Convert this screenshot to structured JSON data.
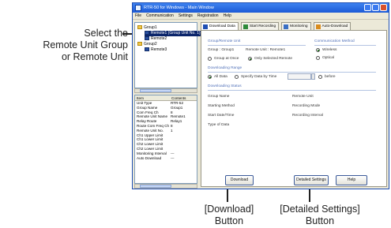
{
  "window": {
    "title": "RTR-50 for Windows - Main Window",
    "menu": [
      "File",
      "Communication",
      "Settings",
      "Registration",
      "Help"
    ]
  },
  "tree": {
    "items": [
      {
        "label": "Group1",
        "type": "folder"
      },
      {
        "label": "Remote1 (Group Unit No. 1)",
        "type": "unit",
        "selected": true
      },
      {
        "label": "Remote2",
        "type": "unit"
      },
      {
        "label": "Group2",
        "type": "folder"
      },
      {
        "label": "Remote3",
        "type": "unit"
      }
    ]
  },
  "props": {
    "head_item": "Item",
    "head_contents": "Contents",
    "rows": [
      {
        "k": "Unit Type",
        "v": "RTR-52"
      },
      {
        "k": "Group Name",
        "v": "Group1"
      },
      {
        "k": "Com Freq Ch",
        "v": "8"
      },
      {
        "k": "Remote Unit Name",
        "v": "Remote1"
      },
      {
        "k": "Relay Route",
        "v": "Relay1"
      },
      {
        "k": "Route Com Freq Ch",
        "v": "8"
      },
      {
        "k": "Remote Unit No.",
        "v": "1"
      },
      {
        "k": "Ch1 Upper Limit",
        "v": ""
      },
      {
        "k": "Ch1 Lower Limit",
        "v": ""
      },
      {
        "k": "Ch2 Lower Limit",
        "v": ""
      },
      {
        "k": "Ch2 Lower Limit",
        "v": ""
      },
      {
        "k": "Monitoring Interval",
        "v": "---"
      },
      {
        "k": "Auto Download",
        "v": "---"
      }
    ]
  },
  "tabs": [
    "Download Data",
    "Start Recording",
    "Monitoring",
    "Auto-Download"
  ],
  "panel": {
    "group_section": "Group/Remote Unit",
    "group_label": "Group : Group1",
    "remote_label": "Remote Unit : Remote1",
    "opt_at_once": "Group at Once",
    "opt_selected": "Only Selected Remote",
    "comm_section": "Communication Method",
    "comm_wireless": "Wireless",
    "comm_optical": "Optical",
    "range_section": "Downloading Range",
    "range_all": "All Data",
    "range_specify": "Specify Data by Time",
    "range_before": "before",
    "status_section": "Downloading Status",
    "status_left": [
      "Group Name",
      "Starting Method",
      "Start Date/Time",
      "Type of Data"
    ],
    "status_right": [
      "Remote Unit",
      "Recording Mode",
      "Recording Interval"
    ],
    "btn_download": "Download",
    "btn_detailed": "Detailed Settings",
    "btn_help": "Help"
  },
  "callouts": {
    "select_1": "Select the",
    "select_2": "Remote Unit Group",
    "select_3": "or Remote Unit",
    "download_1": "[Download]",
    "download_2": "Button",
    "detailed_1": "[Detailed Settings]",
    "detailed_2": "Button"
  }
}
